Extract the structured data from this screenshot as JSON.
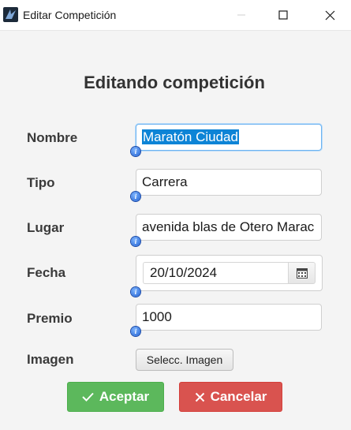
{
  "window": {
    "title": "Editar Competición",
    "icon": "app-logo-icon",
    "controls": [
      "minimize-icon",
      "maximize-icon",
      "close-icon"
    ]
  },
  "form": {
    "heading": "Editando competición",
    "fields": {
      "nombre": {
        "label": "Nombre",
        "value": "Maratón Ciudad",
        "selected": true,
        "focused": true
      },
      "tipo": {
        "label": "Tipo",
        "value": "Carrera"
      },
      "lugar": {
        "label": "Lugar",
        "value": "avenida blas de Otero Marac"
      },
      "fecha": {
        "label": "Fecha",
        "value": "20/10/2024",
        "icon": "calendar-icon"
      },
      "premio": {
        "label": "Premio",
        "value": "1000"
      },
      "imagen": {
        "label": "Imagen",
        "button": "Selecc. Imagen"
      }
    },
    "info_icon": "info-icon"
  },
  "actions": {
    "accept": "Aceptar",
    "cancel": "Cancelar"
  },
  "colors": {
    "accept": "#5cb85c",
    "cancel": "#d9534f",
    "selection": "#0d84d6",
    "focus_border": "#6fb4f0"
  }
}
